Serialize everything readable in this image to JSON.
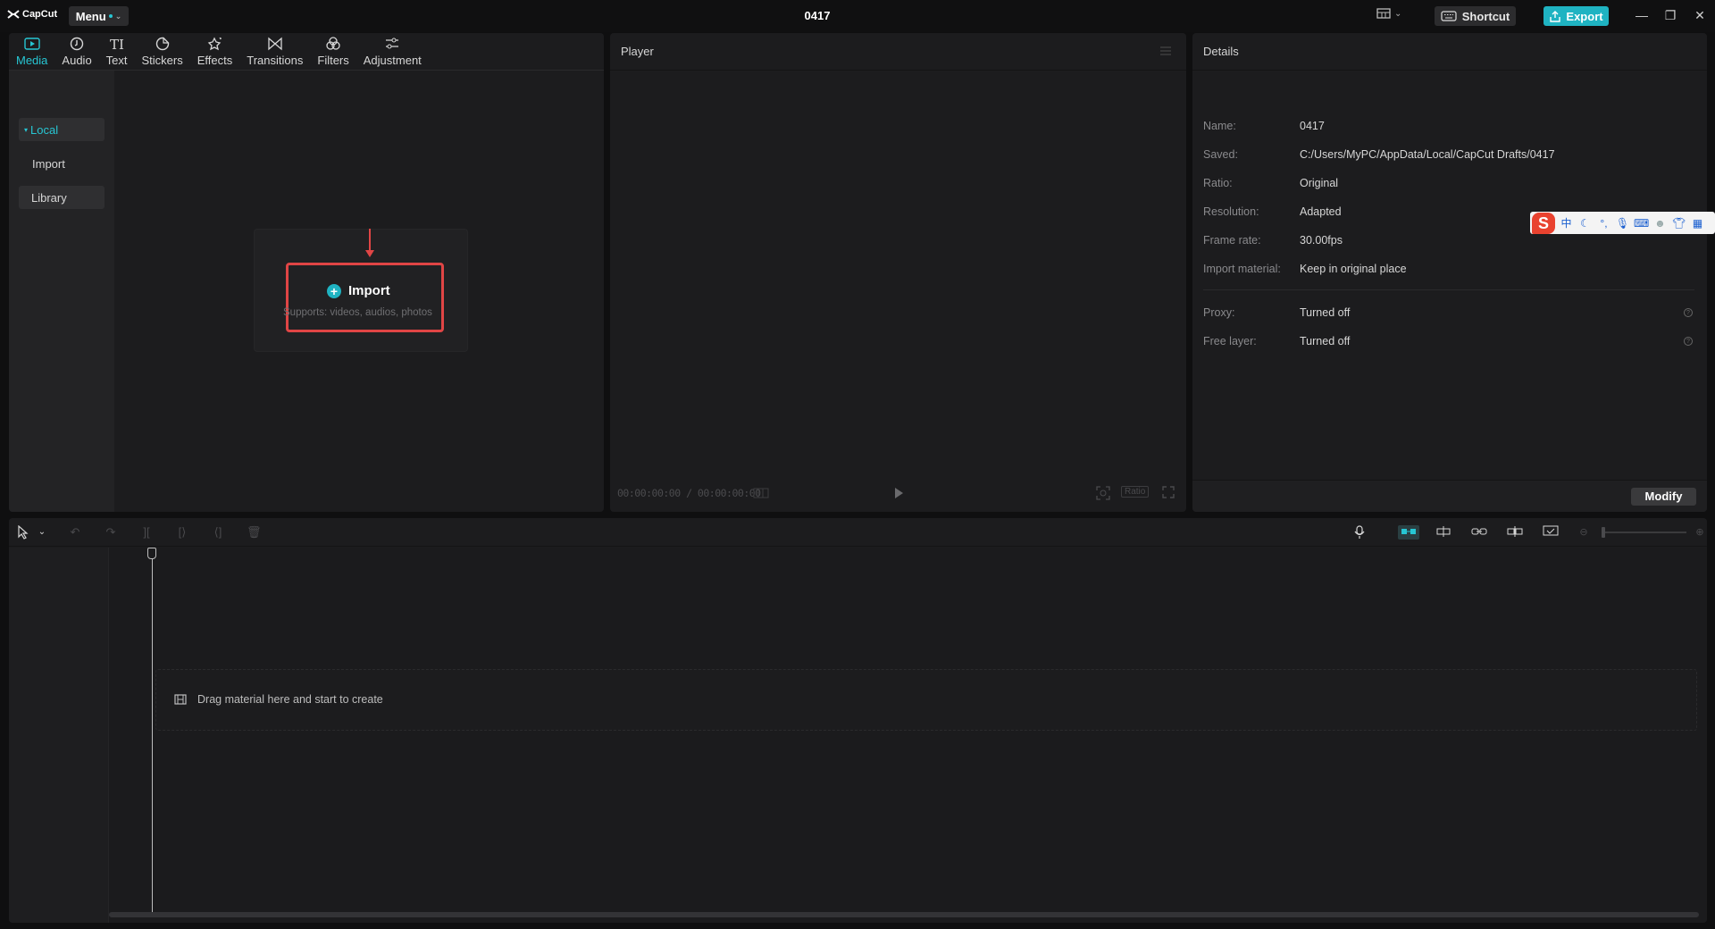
{
  "app": {
    "logo_text": "CapCut",
    "menu_label": "Menu",
    "project_title": "0417",
    "shortcut_label": "Shortcut",
    "export_label": "Export",
    "accent_color": "#27c6d3"
  },
  "tool_tabs": [
    {
      "label": "Media",
      "icon": "media-icon",
      "active": true
    },
    {
      "label": "Audio",
      "icon": "audio-icon"
    },
    {
      "label": "Text",
      "icon": "text-icon"
    },
    {
      "label": "Stickers",
      "icon": "stickers-icon"
    },
    {
      "label": "Effects",
      "icon": "effects-icon"
    },
    {
      "label": "Transitions",
      "icon": "transitions-icon"
    },
    {
      "label": "Filters",
      "icon": "filters-icon"
    },
    {
      "label": "Adjustment",
      "icon": "adjustment-icon"
    }
  ],
  "media_sidebar": {
    "local": "Local",
    "import": "Import",
    "library": "Library"
  },
  "import_card": {
    "button_label": "Import",
    "supports_text": "Supports: videos, audios, photos"
  },
  "player": {
    "title": "Player",
    "timecode": "00:00:00:00 / 00:00:00:00",
    "ratio_label": "Ratio"
  },
  "details": {
    "title": "Details",
    "rows": [
      {
        "key": "Name:",
        "value": "0417"
      },
      {
        "key": "Saved:",
        "value": "C:/Users/MyPC/AppData/Local/CapCut Drafts/0417"
      },
      {
        "key": "Ratio:",
        "value": "Original"
      },
      {
        "key": "Resolution:",
        "value": "Adapted"
      },
      {
        "key": "Frame rate:",
        "value": "30.00fps"
      },
      {
        "key": "Import material:",
        "value": "Keep in original place"
      }
    ],
    "extra_rows": [
      {
        "key": "Proxy:",
        "value": "Turned off"
      },
      {
        "key": "Free layer:",
        "value": "Turned off"
      }
    ],
    "modify_label": "Modify"
  },
  "ime": {
    "chinese_mode": "中"
  },
  "timeline": {
    "drop_text": "Drag material here and start to create"
  }
}
